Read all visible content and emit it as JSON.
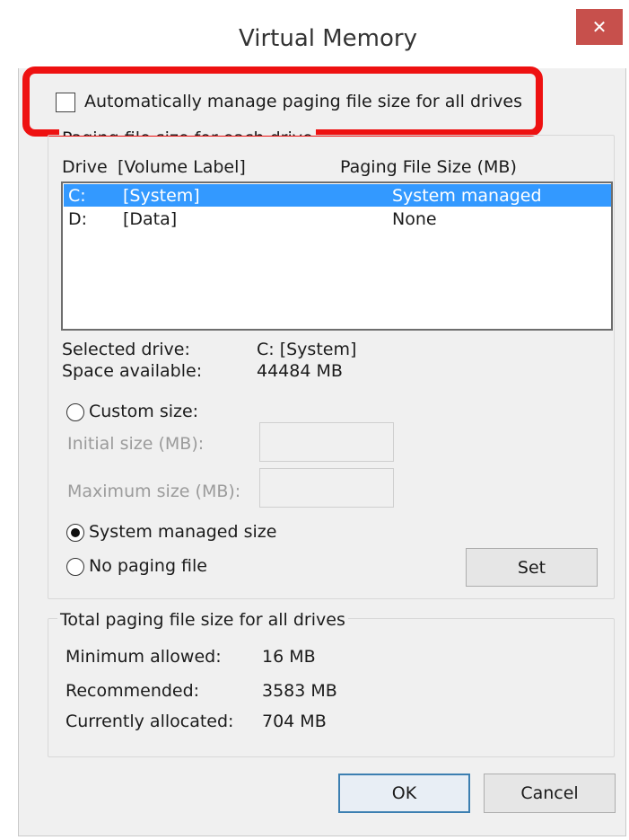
{
  "window": {
    "title": "Virtual Memory",
    "close_glyph": "✕"
  },
  "auto_manage": {
    "label": "Automatically manage paging file size for all drives",
    "checked": false
  },
  "per_drive": {
    "legend": "Paging file size for each drive",
    "col_drive": "Drive",
    "col_volume": "[Volume Label]",
    "col_size": "Paging File Size (MB)",
    "drives": [
      {
        "letter": "C:",
        "label": "[System]",
        "size": "System managed",
        "selected": true
      },
      {
        "letter": "D:",
        "label": "[Data]",
        "size": "None",
        "selected": false
      }
    ],
    "selected_drive_label": "Selected drive:",
    "selected_drive_value": "C:  [System]",
    "space_available_label": "Space available:",
    "space_available_value": "44484 MB",
    "custom_size_label": "Custom size:",
    "initial_size_label": "Initial size (MB):",
    "initial_size_value": "",
    "maximum_size_label": "Maximum size (MB):",
    "maximum_size_value": "",
    "system_managed_label": "System managed size",
    "no_paging_label": "No paging file",
    "selected_option": "system_managed",
    "set_button": "Set"
  },
  "totals": {
    "legend": "Total paging file size for all drives",
    "minimum_label": "Minimum allowed:",
    "minimum_value": "16 MB",
    "recommended_label": "Recommended:",
    "recommended_value": "3583 MB",
    "allocated_label": "Currently allocated:",
    "allocated_value": "704 MB"
  },
  "buttons": {
    "ok": "OK",
    "cancel": "Cancel"
  },
  "colors": {
    "highlight_ring": "#ee1111",
    "selection": "#3399ff",
    "close_button": "#c7504c"
  }
}
